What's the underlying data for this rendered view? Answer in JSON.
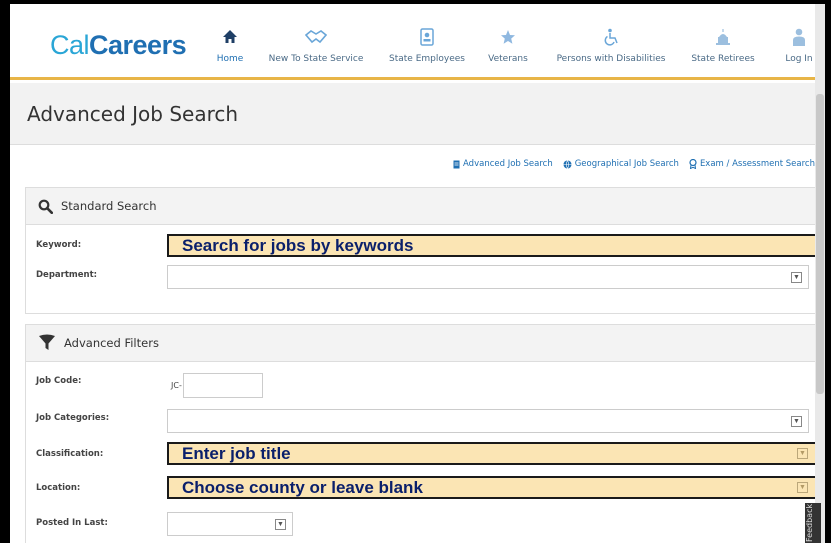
{
  "header": {
    "logo_cal": "Cal",
    "logo_careers": "Careers",
    "nav": [
      {
        "label": "Home",
        "icon": "home-icon"
      },
      {
        "label": "New To State Service",
        "icon": "handshake-icon"
      },
      {
        "label": "State Employees",
        "icon": "badge-icon"
      },
      {
        "label": "Veterans",
        "icon": "star-icon"
      },
      {
        "label": "Persons with Disabilities",
        "icon": "wheelchair-icon"
      },
      {
        "label": "State Retirees",
        "icon": "capitol-icon"
      },
      {
        "label": "Log In",
        "icon": "user-icon"
      }
    ]
  },
  "page_title": "Advanced Job Search",
  "search_links": {
    "advanced": "Advanced Job Search",
    "geographical": "Geographical Job Search",
    "exam": "Exam / Assessment Search"
  },
  "standard_search": {
    "title": "Standard Search",
    "keyword_label": "Keyword:",
    "keyword_callout": "Search for jobs by keywords",
    "department_label": "Department:"
  },
  "advanced_filters": {
    "title": "Advanced Filters",
    "job_code_label": "Job Code:",
    "job_code_prefix": "JC-",
    "job_categories_label": "Job Categories:",
    "classification_label": "Classification:",
    "classification_callout": "Enter job title",
    "location_label": "Location:",
    "location_callout": "Choose county or leave blank",
    "posted_label": "Posted In Last:"
  },
  "feedback_tab": "Feedback",
  "colors": {
    "accent_blue": "#1f6fb2",
    "logo_light_blue": "#2aa6d6",
    "header_rule": "#e8b547",
    "callout_fill": "#fbe5b4",
    "callout_text": "#0a1f6b"
  }
}
